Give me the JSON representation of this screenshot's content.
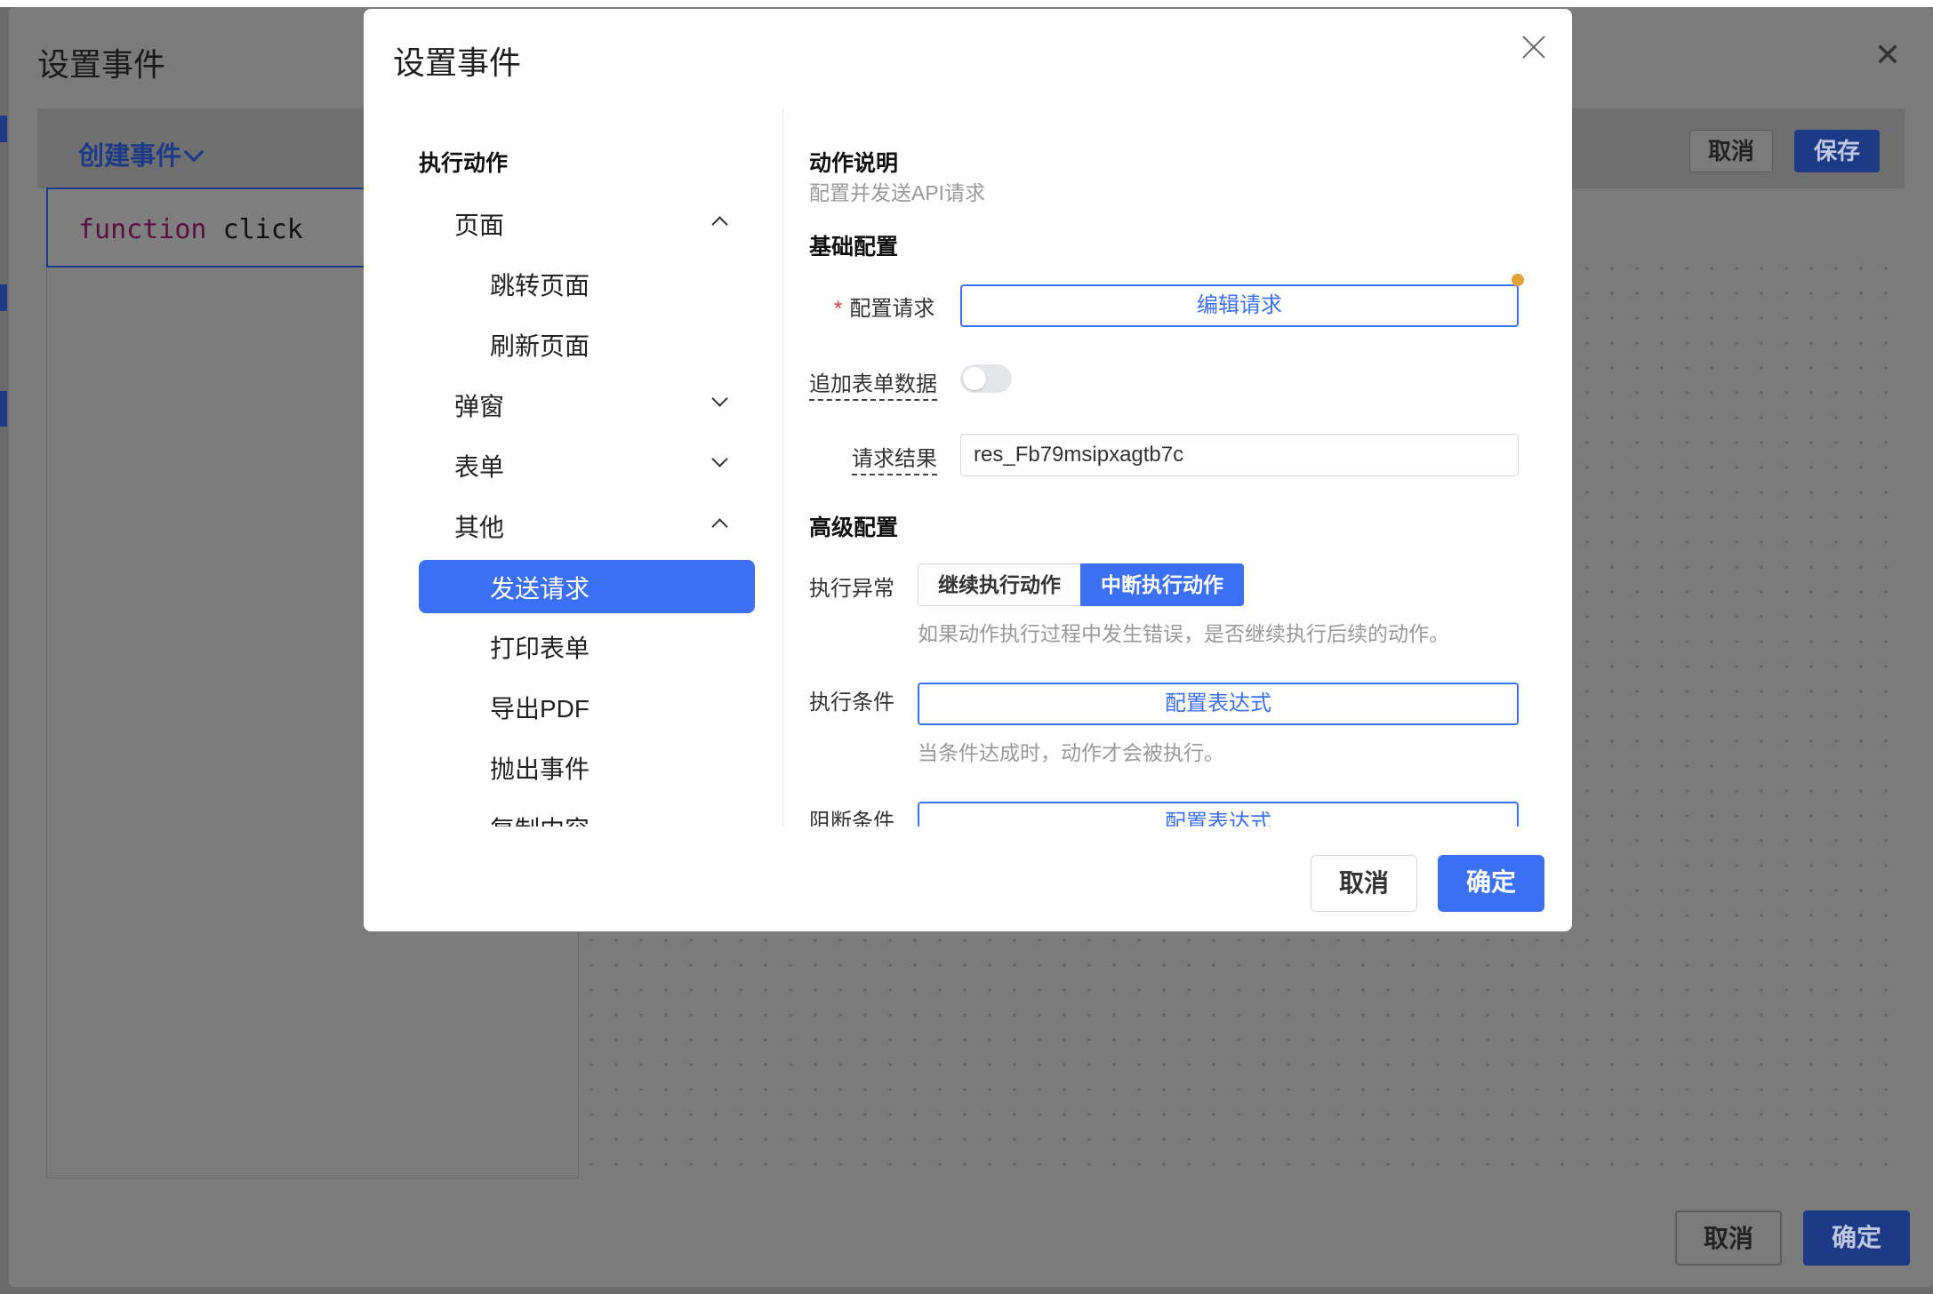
{
  "outer": {
    "title": "设置事件",
    "create_event": "创建事件",
    "code_keyword": "function",
    "code_name": "click",
    "cancel_top": "取消",
    "save_top": "保存",
    "cancel_bottom": "取消",
    "ok_bottom": "确定"
  },
  "modal": {
    "title": "设置事件",
    "tree": {
      "title": "执行动作",
      "groups": [
        {
          "label": "页面",
          "expanded": true,
          "items": [
            "跳转页面",
            "刷新页面"
          ]
        },
        {
          "label": "弹窗",
          "expanded": false
        },
        {
          "label": "表单",
          "expanded": false
        },
        {
          "label": "其他",
          "expanded": true,
          "items": [
            "发送请求",
            "打印表单",
            "导出PDF",
            "抛出事件",
            "复制内容"
          ]
        }
      ],
      "selected": "发送请求"
    },
    "panel": {
      "desc_title": "动作说明",
      "desc_text": "配置并发送API请求",
      "basic_title": "基础配置",
      "config_request_label": "配置请求",
      "edit_request_button": "编辑请求",
      "append_form_label": "追加表单数据",
      "append_form_on": false,
      "result_label": "请求结果",
      "result_value": "res_Fb79msipxagtb7c",
      "advanced_title": "高级配置",
      "exception_label": "执行异常",
      "exception_options": [
        "继续执行动作",
        "中断执行动作"
      ],
      "exception_selected": "中断执行动作",
      "exception_hint": "如果动作执行过程中发生错误，是否继续执行后续的动作。",
      "condition_label": "执行条件",
      "condition_button": "配置表达式",
      "condition_hint": "当条件达成时，动作才会被执行。",
      "block_label": "阻断条件",
      "block_button": "配置表达式"
    },
    "cancel": "取消",
    "ok": "确定"
  },
  "colors": {
    "primary": "#3b6ff5",
    "overlay_primary": "#1c3a85",
    "required": "#e03a3a",
    "dot": "#e5a13c"
  }
}
